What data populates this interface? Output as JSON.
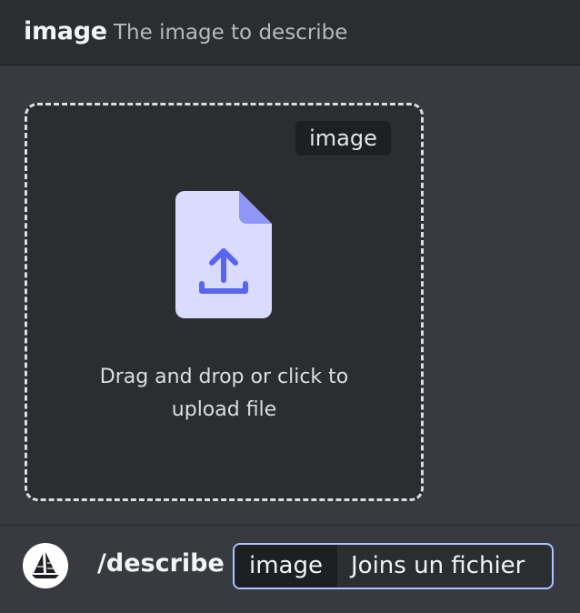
{
  "header": {
    "option_name": "image",
    "option_description": "The image to describe"
  },
  "dropzone": {
    "tag_label": "image",
    "instruction_line1": "Drag and drop or click to",
    "instruction_line2": "upload file",
    "icon": "file-upload-icon"
  },
  "command_bar": {
    "avatar_icon": "sailboat-logo-icon",
    "command": "/describe",
    "option_chip": {
      "name": "image",
      "value": "Joins un fichier"
    }
  },
  "colors": {
    "background": "#383a40",
    "panel": "#2b2d31",
    "chip_dark": "#1e1f22",
    "chip_border": "#a9c6ff",
    "upload_accent": "#5865f2",
    "file_body": "#d9dbff"
  }
}
